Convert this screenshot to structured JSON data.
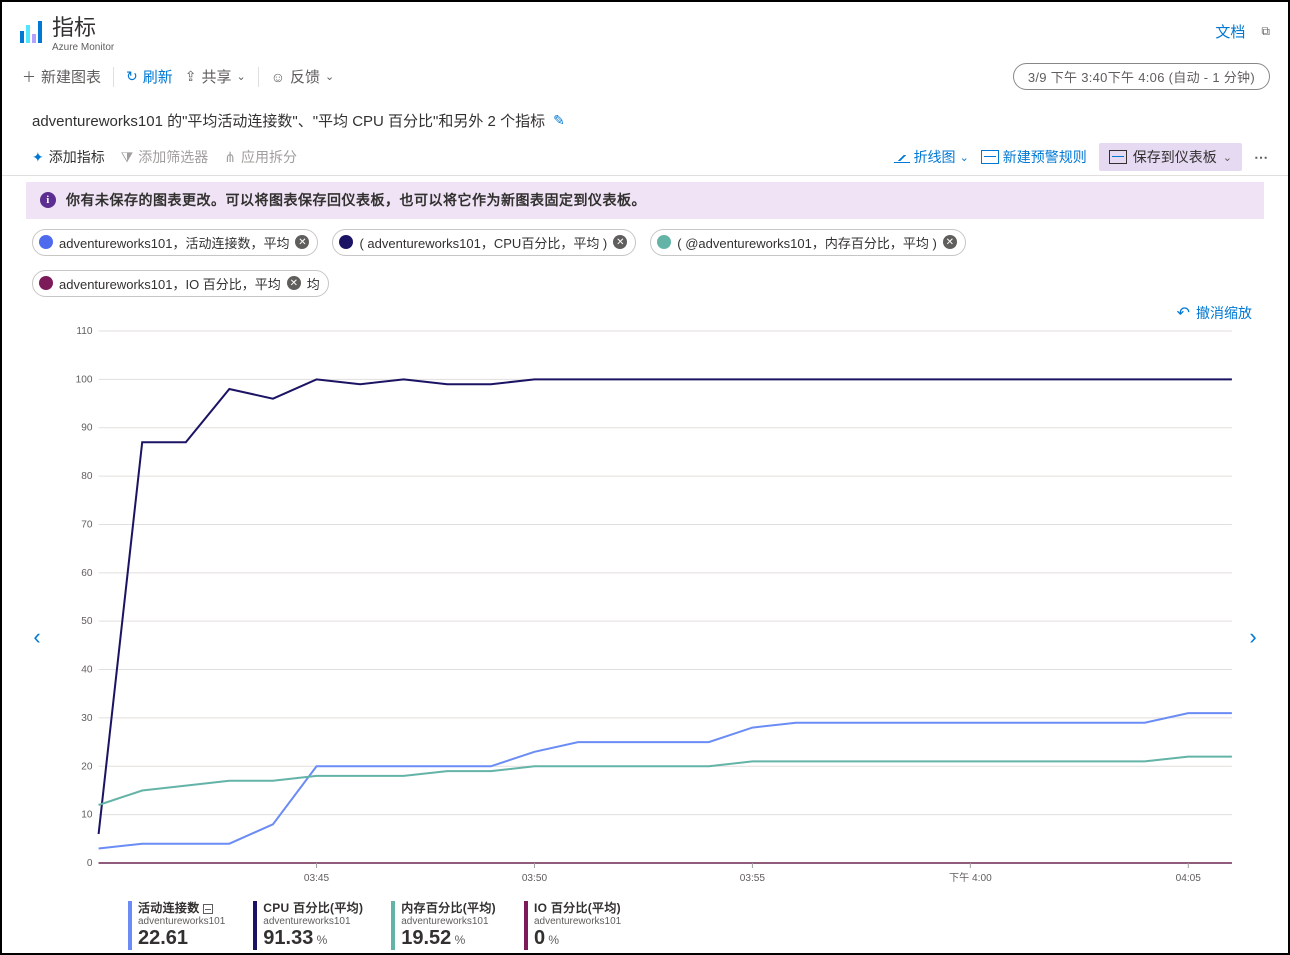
{
  "header": {
    "title": "指标",
    "subtitle": "Azure Monitor",
    "docs_link": "文档"
  },
  "toolbar": {
    "new_chart": "新建图表",
    "refresh": "刷新",
    "share": "共享",
    "feedback": "反馈",
    "time_range": "3/9 下午 3:40下午 4:06 (自动 - 1 分钟)"
  },
  "chart_title": "adventureworks101 的\"平均活动连接数\"、\"平均 CPU 百分比\"和另外 2 个指标",
  "chart_toolbar": {
    "add_metric": "添加指标",
    "add_filter": "添加筛选器",
    "apply_split": "应用拆分",
    "line_chart": "折线图",
    "new_alert_rule": "新建预警规则",
    "save_to_dashboard": "保存到仪表板"
  },
  "banner": "你有未保存的图表更改。可以将图表保存回仪表板，也可以将它作为新图表固定到仪表板。",
  "pills": [
    {
      "label": "adventureworks101，活动连接数，平均",
      "color": "#4f6bed"
    },
    {
      "label": "adventureworks101，CPU百分比，平均",
      "color": "#1b1464",
      "open_paren": true
    },
    {
      "label": "@adventureworks101，内存百分比，平均",
      "color": "#63b3a7",
      "open_paren": true
    },
    {
      "label": "adventureworks101，IO 百分比，平均",
      "color": "#7d1a5a",
      "tail": "均"
    }
  ],
  "undo_zoom": "撤消缩放",
  "legend": [
    {
      "name": "活动连接数",
      "scope": "adventureworks101",
      "value": "22.61",
      "unit": "",
      "color": "#6b8cf5",
      "trunc": true
    },
    {
      "name": "CPU 百分比(平均)",
      "scope": "adventureworks101",
      "value": "91.33",
      "unit": "%",
      "color": "#1b1464"
    },
    {
      "name": "内存百分比(平均)",
      "scope": "adventureworks101",
      "value": "19.52",
      "unit": "%",
      "color": "#63b3a7"
    },
    {
      "name": "IO 百分比(平均)",
      "scope": "adventureworks101",
      "value": "0",
      "unit": "%",
      "color": "#7d1a5a"
    }
  ],
  "chart_data": {
    "type": "line",
    "x": [
      "03:40",
      "03:41",
      "03:42",
      "03:43",
      "03:44",
      "03:45",
      "03:46",
      "03:47",
      "03:48",
      "03:49",
      "03:50",
      "03:51",
      "03:52",
      "03:53",
      "03:54",
      "03:55",
      "03:56",
      "03:57",
      "03:58",
      "03:59",
      "下午 4:00",
      "04:01",
      "04:02",
      "04:03",
      "04:04",
      "04:05",
      "04:06"
    ],
    "x_ticks_labeled": [
      "03:45",
      "03:50",
      "03:55",
      "下午 4:00",
      "04:05"
    ],
    "ylim": [
      0,
      110
    ],
    "y_ticks": [
      0,
      10,
      20,
      30,
      40,
      50,
      60,
      70,
      80,
      90,
      100,
      110
    ],
    "series": [
      {
        "name": "活动连接数",
        "color": "#6b8cf5",
        "values": [
          3,
          4,
          4,
          4,
          8,
          20,
          20,
          20,
          20,
          20,
          23,
          25,
          25,
          25,
          25,
          28,
          29,
          29,
          29,
          29,
          29,
          29,
          29,
          29,
          29,
          31,
          31
        ]
      },
      {
        "name": "CPU 百分比",
        "color": "#1b1464",
        "values": [
          6,
          87,
          87,
          98,
          96,
          100,
          99,
          100,
          99,
          99,
          100,
          100,
          100,
          100,
          100,
          100,
          100,
          100,
          100,
          100,
          100,
          100,
          100,
          100,
          100,
          100,
          100
        ]
      },
      {
        "name": "内存百分比",
        "color": "#63b3a7",
        "values": [
          12,
          15,
          16,
          17,
          17,
          18,
          18,
          18,
          19,
          19,
          20,
          20,
          20,
          20,
          20,
          21,
          21,
          21,
          21,
          21,
          21,
          21,
          21,
          21,
          21,
          22,
          22
        ]
      },
      {
        "name": "IO 百分比",
        "color": "#7d1a5a",
        "values": [
          0,
          0,
          0,
          0,
          0,
          0,
          0,
          0,
          0,
          0,
          0,
          0,
          0,
          0,
          0,
          0,
          0,
          0,
          0,
          0,
          0,
          0,
          0,
          0,
          0,
          0,
          0
        ]
      }
    ]
  }
}
